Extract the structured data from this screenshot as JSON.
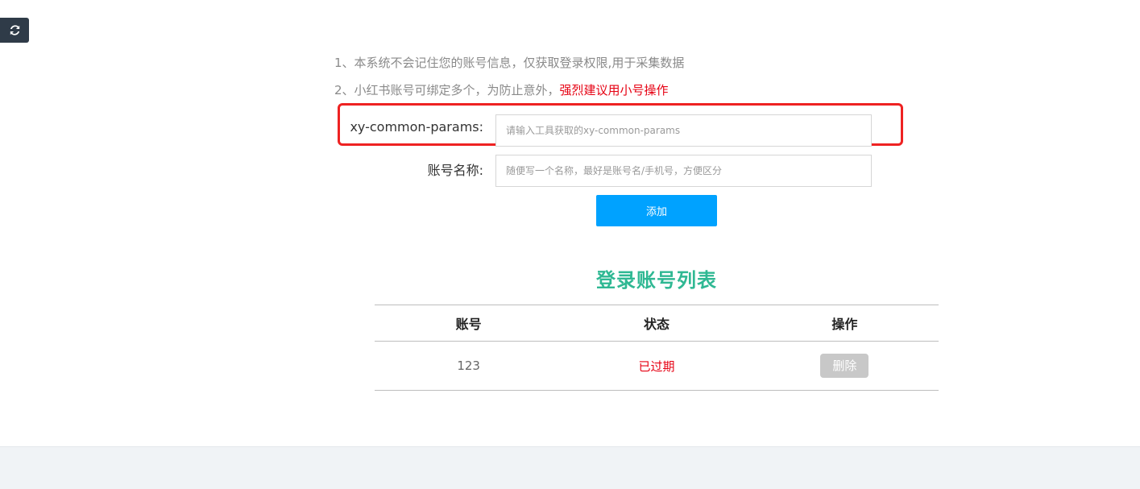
{
  "toolbar": {
    "refresh_icon": "refresh-icon"
  },
  "notices": {
    "line1": "1、本系统不会记住您的账号信息，仅获取登录权限,用于采集数据",
    "line2_prefix": "2、小红书账号可绑定多个，为防止意外，",
    "line2_warning": "强烈建议用小号操作"
  },
  "form": {
    "params_label": "xy-common-params:",
    "params_placeholder": "请输入工具获取的xy-common-params",
    "params_value": "",
    "name_label": "账号名称:",
    "name_placeholder": "随便写一个名称，最好是账号名/手机号，方便区分",
    "name_value": "",
    "add_label": "添加"
  },
  "accounts": {
    "title": "登录账号列表",
    "columns": [
      "账号",
      "状态",
      "操作"
    ],
    "rows": [
      {
        "account": "123",
        "status": "已过期",
        "action": "删除"
      }
    ]
  },
  "colors": {
    "primary_button": "#00a2ff",
    "title_green": "#2fb893",
    "warning_red": "#e60012",
    "highlight_border": "#ee2222",
    "refresh_bg": "#2f3b48"
  }
}
